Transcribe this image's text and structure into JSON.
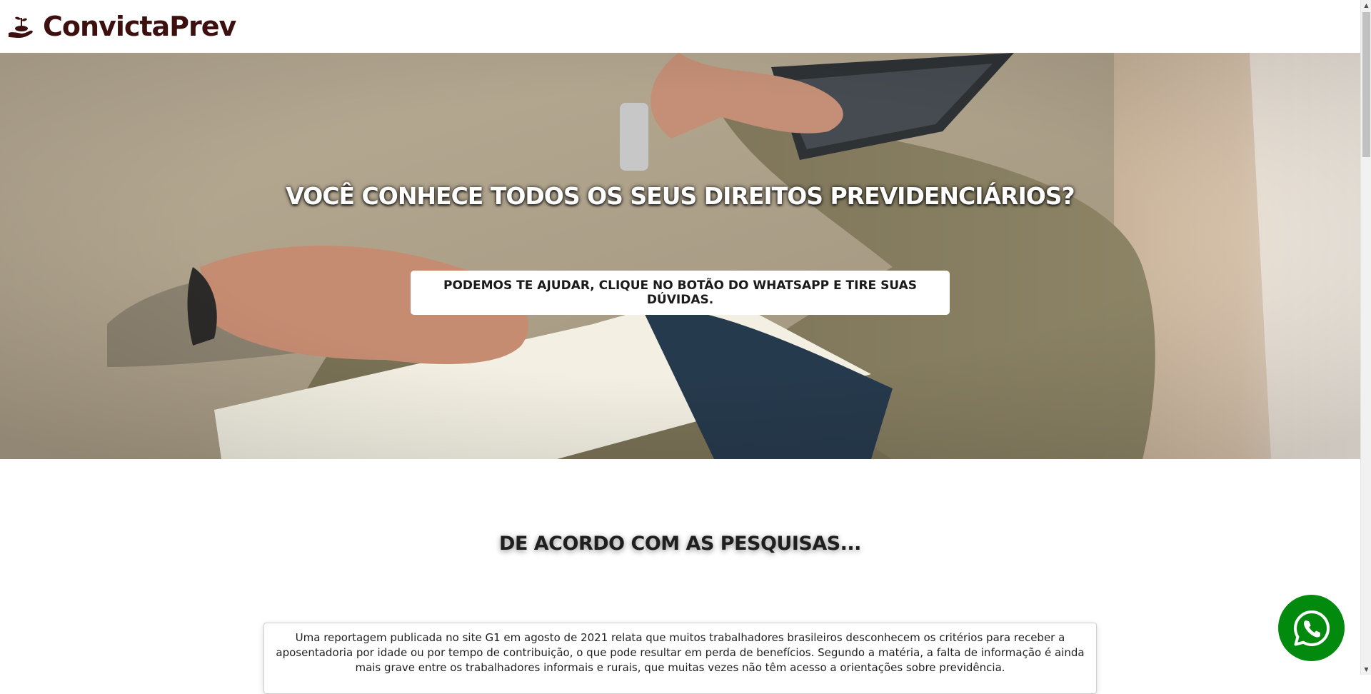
{
  "header": {
    "brand_name": "ConvictaPrev",
    "brand_icon": "hand-holding-seedling-icon",
    "brand_color": "#3d0f0f"
  },
  "hero": {
    "title": "VOCÊ CONHECE TODOS OS SEUS DIREITOS PREVIDENCIÁRIOS?",
    "cta_label": "PODEMOS TE AJUDAR, CLIQUE NO BOTÃO DO WHATSAPP E TIRE SUAS DÚVIDAS."
  },
  "research": {
    "title": "DE ACORDO COM AS PESQUISAS...",
    "text": "Uma reportagem publicada no site G1 em agosto de 2021 relata que muitos trabalhadores brasileiros desconhecem os critérios para receber a aposentadoria por idade ou por tempo de contribuição, o que pode resultar em perda de benefícios. Segundo a matéria, a falta de informação é ainda mais grave entre os trabalhadores informais e rurais, que muitas vezes não têm acesso a orientações sobre previdência."
  },
  "whatsapp": {
    "icon": "whatsapp-icon",
    "color": "#028a0f"
  },
  "scrollbar": {
    "up_arrow": "▲",
    "down_arrow": "▼"
  }
}
